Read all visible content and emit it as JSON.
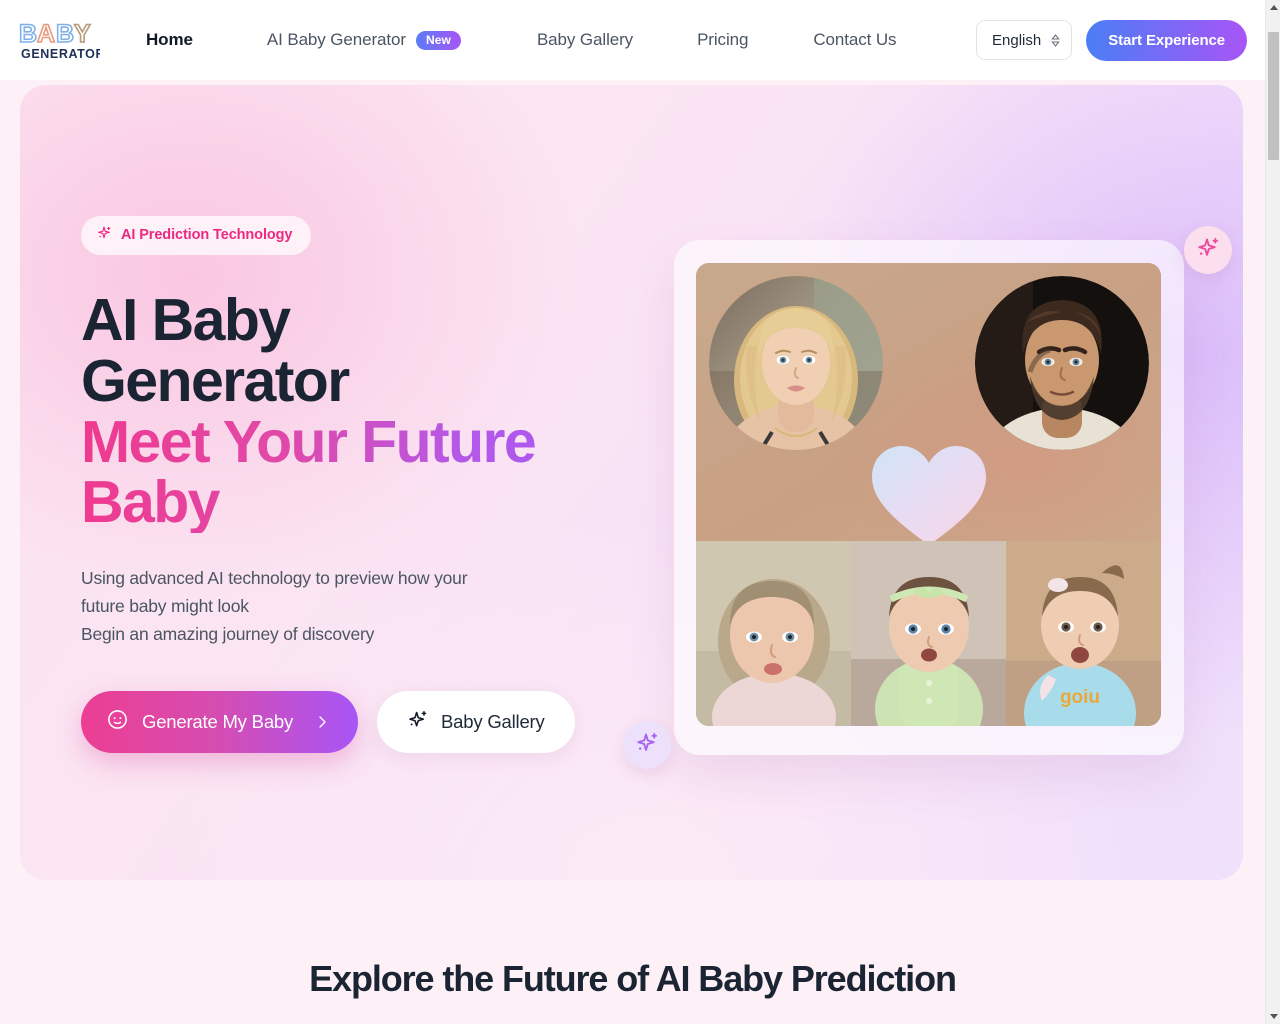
{
  "brand": {
    "logo_line1": "BABY",
    "logo_line2": "GENERATOR",
    "logo_colors": [
      "#8fb6e8",
      "#e8a085",
      "#8fb6e8",
      "#bda храм"
    ]
  },
  "header": {
    "nav": [
      {
        "label": "Home",
        "active": true,
        "badge": null
      },
      {
        "label": "AI Baby Generator",
        "active": false,
        "badge": "New"
      },
      {
        "label": "Baby Gallery",
        "active": false,
        "badge": null
      },
      {
        "label": "Pricing",
        "active": false,
        "badge": null
      },
      {
        "label": "Contact Us",
        "active": false,
        "badge": null
      }
    ],
    "language": "English",
    "cta_label": "Start Experience"
  },
  "hero": {
    "pill_label": "AI Prediction Technology",
    "title_line1": "AI Baby",
    "title_line2": "Generator",
    "title_gradient": "Meet Your Future Baby",
    "sub_line1": "Using advanced AI technology to preview how your",
    "sub_line2": "future baby might look",
    "sub_line3": "Begin an amazing journey of discovery",
    "primary_cta": "Generate My Baby",
    "secondary_cta": "Baby Gallery"
  },
  "section": {
    "title": "Explore the Future of AI Baby Prediction"
  },
  "colors": {
    "accent_pink": "#ec3e93",
    "accent_purple": "#a855f7",
    "text_dark": "#1b2433",
    "text_muted": "#4b5563",
    "page_bg": "#fdf0f6"
  }
}
